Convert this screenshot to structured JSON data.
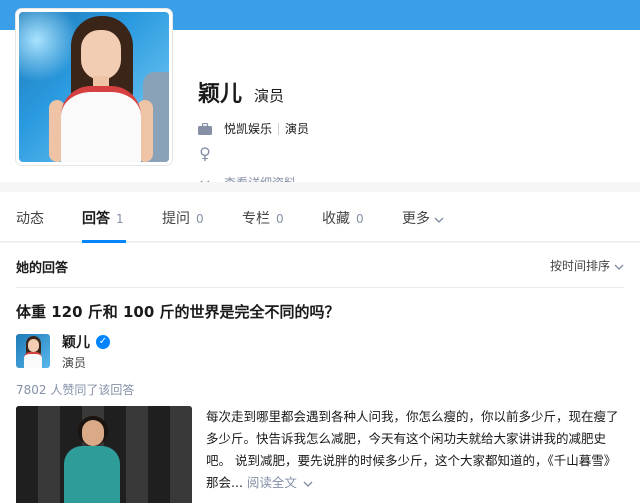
{
  "profile": {
    "name": "颖儿",
    "headline": "演员",
    "company": "悦凯娱乐",
    "job": "演员",
    "gender_symbol": "♀",
    "details_link": "查看详细资料",
    "icons": {
      "company": "briefcase-icon",
      "gender": "female-icon",
      "expand": "chevron-down-icon"
    }
  },
  "tabs": [
    {
      "label": "动态",
      "count": ""
    },
    {
      "label": "回答",
      "count": "1"
    },
    {
      "label": "提问",
      "count": "0"
    },
    {
      "label": "专栏",
      "count": "0"
    },
    {
      "label": "收藏",
      "count": "0"
    },
    {
      "label": "更多",
      "count": ""
    }
  ],
  "answers_section": {
    "title": "她的回答",
    "sort_label": "按时间排序"
  },
  "answer": {
    "question": "体重 120 斤和 100 斤的世界是完全不同的吗？",
    "author_name": "颖儿",
    "author_headline": "演员",
    "votes": "7802 人赞同了该回答",
    "excerpt": "每次走到哪里都会遇到各种人问我，你怎么瘦的，你以前多少斤，现在瘦了多少斤。快告诉我怎么减肥，今天有这个闲功夫就给大家讲讲我的减肥史吧。 说到减肥，要先说胖的时候多少斤，这个大家都知道的，《千山暮雪》那会...",
    "read_more": "阅读全文"
  },
  "colors": {
    "banner": "#3a9ee8",
    "accent": "#0084ff",
    "muted": "#8590a6"
  }
}
